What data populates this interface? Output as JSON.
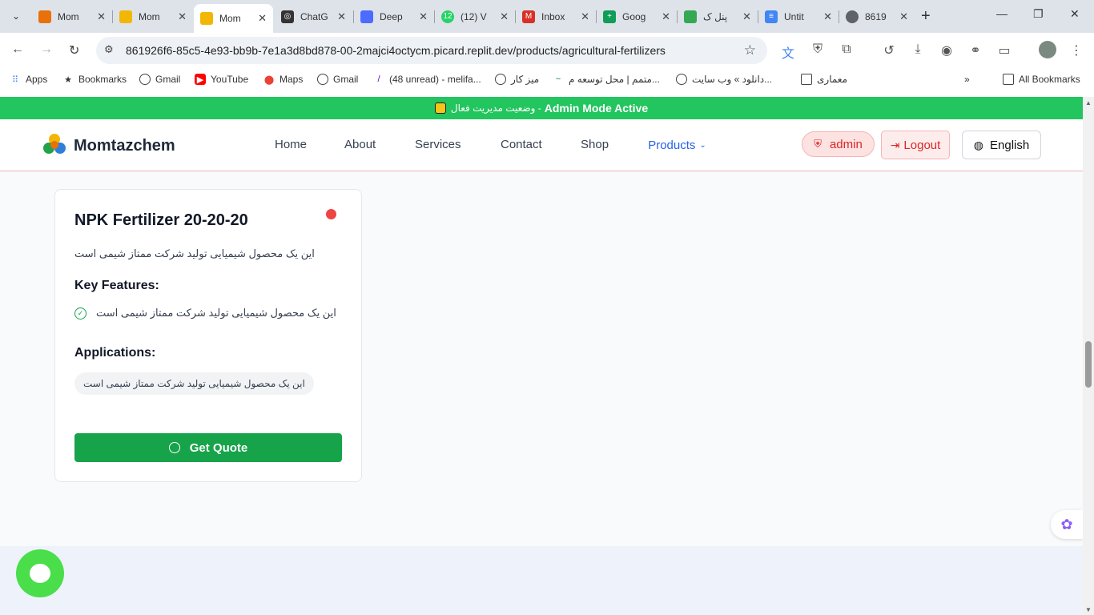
{
  "browser": {
    "tabs": [
      {
        "label": "Mom",
        "favicon": "fertilizer-icon",
        "color": "#e8710a"
      },
      {
        "label": "Mom",
        "favicon": "momtazchem-logo-icon",
        "color": "#f2b705"
      },
      {
        "label": "Mom",
        "favicon": "momtazchem-logo-icon",
        "color": "#f2b705",
        "active": true
      },
      {
        "label": "ChatG",
        "favicon": "chatgpt-icon",
        "color": "#333333"
      },
      {
        "label": "Deep",
        "favicon": "deepseek-icon",
        "color": "#4d6bfe"
      },
      {
        "label": "(12) V",
        "favicon": "whatsapp-icon",
        "color": "#25d366"
      },
      {
        "label": "Inbox",
        "favicon": "gmail-icon",
        "color": "#d93025"
      },
      {
        "label": "Goog",
        "favicon": "google-sheets-plus-icon",
        "color": "#0f9d58"
      },
      {
        "label": "پنل ک",
        "favicon": "shield-icon",
        "color": "#34a853"
      },
      {
        "label": "Untit",
        "favicon": "google-docs-icon",
        "color": "#4285f4"
      },
      {
        "label": "8619",
        "favicon": "globe-icon",
        "color": "#5f6368"
      }
    ],
    "url": "861926f6-85c5-4e93-bb9b-7e1a3d8bd878-00-2majci4octycm.picard.replit.dev/products/agricultural-fertilizers",
    "bookmarks": [
      {
        "label": "Apps",
        "icon": "apps-grid-icon"
      },
      {
        "label": "Bookmarks",
        "icon": "star-icon"
      },
      {
        "label": "Gmail",
        "icon": "globe-icon"
      },
      {
        "label": "YouTube",
        "icon": "youtube-icon"
      },
      {
        "label": "Maps",
        "icon": "maps-pin-icon"
      },
      {
        "label": "Gmail",
        "icon": "globe-icon"
      },
      {
        "label": "(48 unread) - melifa...",
        "icon": "yahoo-icon"
      },
      {
        "label": "میز کار",
        "icon": "globe-icon"
      },
      {
        "label": "متمم | محل توسعه م...",
        "icon": "motamem-icon"
      },
      {
        "label": "دانلود » وب سایت...",
        "icon": "globe-icon"
      },
      {
        "label": "معماری",
        "icon": "folder-icon"
      },
      {
        "label": "All Bookmarks",
        "icon": "folder-icon"
      }
    ]
  },
  "admin_bar": {
    "text": "Admin Mode Active",
    "text_fa": "وضعیت مدیریت فعال -"
  },
  "header": {
    "brand": "Momtazchem",
    "nav": [
      "Home",
      "About",
      "Services",
      "Contact",
      "Shop"
    ],
    "products_label": "Products",
    "admin_label": "admin",
    "logout_label": "Logout",
    "language_label": "English"
  },
  "product": {
    "title": "NPK Fertilizer 20-20-20",
    "description": "این یک محصول شیمیایی تولید شرکت ممتاز شیمی است",
    "features_heading": "Key Features:",
    "features": [
      "این یک محصول شیمیایی تولید شرکت ممتاز شیمی است"
    ],
    "applications_heading": "Applications:",
    "applications": [
      "این یک محصول شیمیایی تولید شرکت ممتاز شیمی است"
    ],
    "quote_button": "Get Quote",
    "status_color": "#ef4444"
  },
  "colors": {
    "accent": "#16a34a",
    "admin_bar": "#22c55e",
    "link": "#2563eb"
  }
}
